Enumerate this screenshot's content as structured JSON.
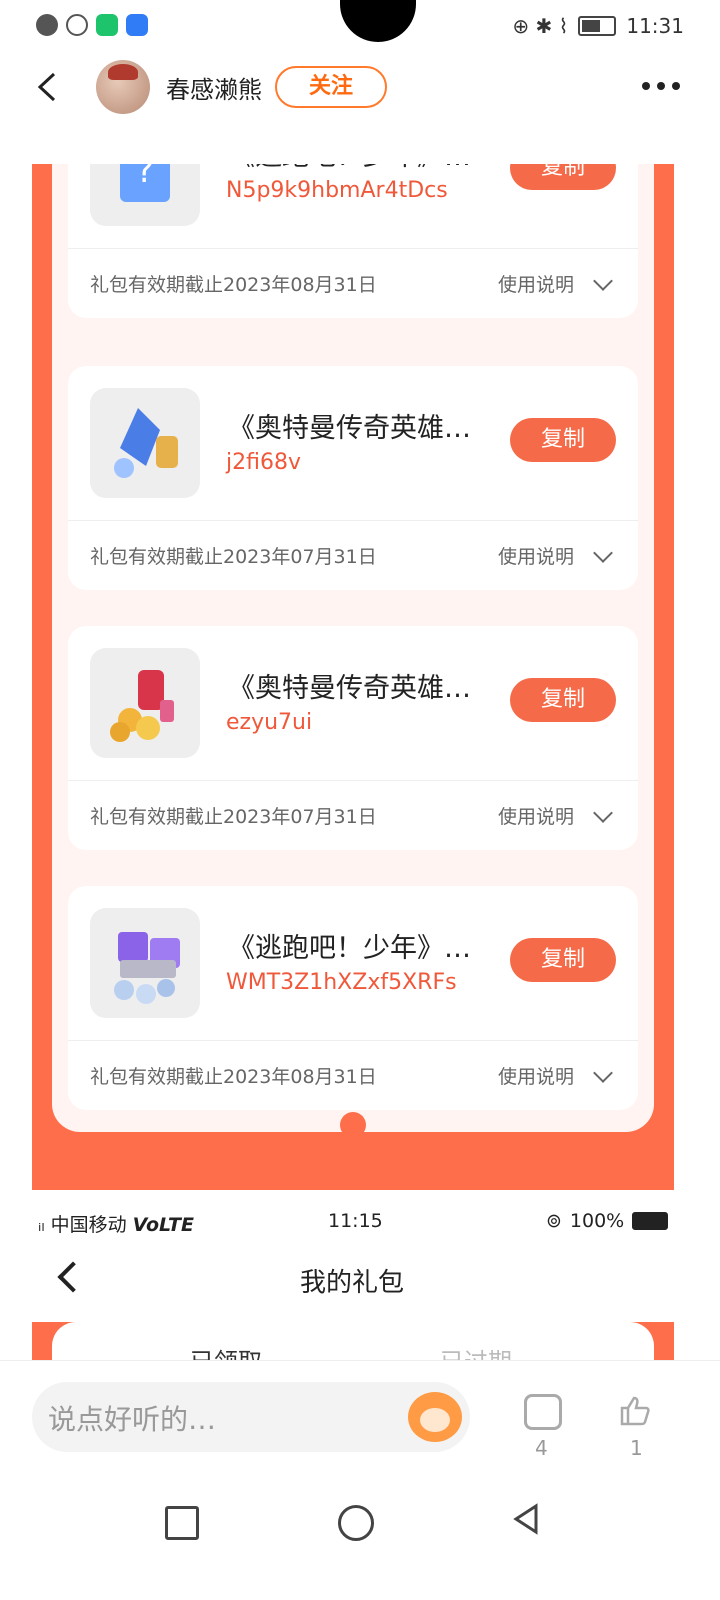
{
  "status_bar": {
    "time": "11:31"
  },
  "header": {
    "username": "春感濑熊",
    "follow_label": "关注"
  },
  "gift_cards": [
    {
      "title": "《逃跑吧！少年》金…",
      "code": "N5p9k9hbmAr4tDcs",
      "copy_label": "复制",
      "expiry": "礼包有效期截止2023年08月31日",
      "instructions_label": "使用说明",
      "thumb_color": "#6aa2ff"
    },
    {
      "title": "《奥特曼传奇英雄》…",
      "code": "j2fi68v",
      "copy_label": "复制",
      "expiry": "礼包有效期截止2023年07月31日",
      "instructions_label": "使用说明",
      "thumb_color": "#4a7de6"
    },
    {
      "title": "《奥特曼传奇英雄》…",
      "code": "ezyu7ui",
      "copy_label": "复制",
      "expiry": "礼包有效期截止2023年07月31日",
      "instructions_label": "使用说明",
      "thumb_color": "#f2b43a"
    },
    {
      "title": "《逃跑吧！少年》蔚…",
      "code": "WMT3Z1hXZxf5XRFs",
      "copy_label": "复制",
      "expiry": "礼包有效期截止2023年08月31日",
      "instructions_label": "使用说明",
      "thumb_color": "#8a63e8"
    }
  ],
  "embedded_screenshot": {
    "carrier": "中国移动",
    "volte": "VoLTE",
    "time": "11:15",
    "battery": "100%",
    "page_title": "我的礼包",
    "tabs": [
      "已领取",
      "已过期"
    ]
  },
  "comment_bar": {
    "placeholder": "说点好听的…",
    "comment_count": "4",
    "like_count": "1"
  },
  "colors": {
    "accent": "#ff6e4a",
    "code_text": "#f0583a",
    "follow_border": "#ff7a2a"
  }
}
